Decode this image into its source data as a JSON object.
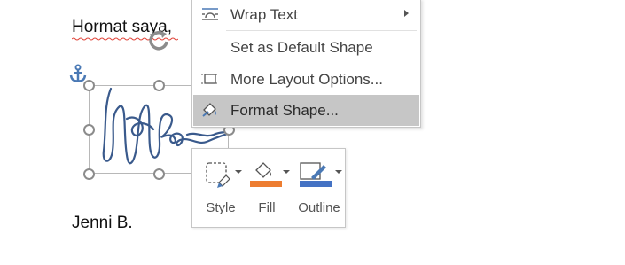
{
  "document": {
    "greeting": "Hormat saya,",
    "closing": "Jenni B."
  },
  "context_menu": {
    "items": [
      {
        "label": "Wrap Text",
        "icon": "wrap-text-icon",
        "has_submenu": true
      },
      {
        "label": "Set as Default Shape",
        "icon": "",
        "has_submenu": false
      },
      {
        "label": "More Layout Options...",
        "icon": "layout-options-icon",
        "has_submenu": false
      },
      {
        "label": "Format Shape...",
        "icon": "format-shape-icon",
        "has_submenu": false,
        "highlighted": true
      }
    ]
  },
  "mini_toolbar": {
    "style_label": "Style",
    "fill_label": "Fill",
    "outline_label": "Outline",
    "fill_color": "#ED7D31",
    "outline_color": "#4472C4"
  },
  "colors": {
    "ink": "#3A5A8C",
    "menu_highlight": "#C6C6C6",
    "anchor": "#4A79B5",
    "spellcheck": "#E0443A"
  }
}
